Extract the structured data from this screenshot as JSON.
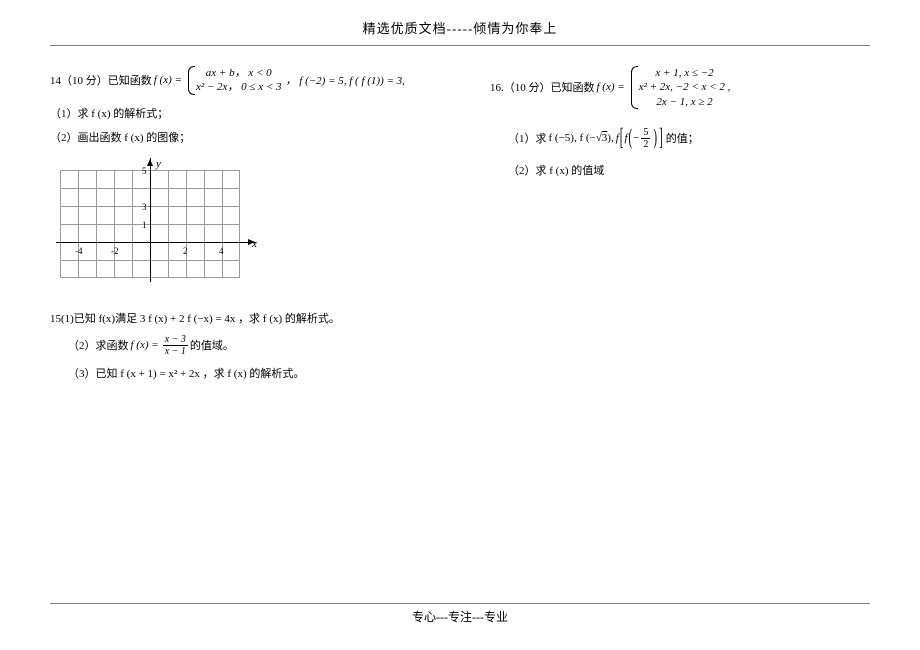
{
  "header": {
    "title": "精选优质文档-----倾情为你奉上"
  },
  "footer": {
    "text": "专心---专注---专业"
  },
  "q14": {
    "stem": "14（10 分）已知函数",
    "fx": "f (x) =",
    "case1": "ax + b，  x < 0",
    "case2": "x² − 2x，  0 ≤ x < 3",
    "tail": "， f (−2) = 5, f ( f (1)) = 3,",
    "p1": "（1）求 f (x) 的解析式；",
    "p2": "（2）画出函数 f (x) 的图像；"
  },
  "grid": {
    "y_label": "y",
    "x_label": "x",
    "x_ticks": [
      "-4",
      "-2",
      "2",
      "4"
    ],
    "y_ticks": [
      "5",
      "3",
      "1"
    ]
  },
  "q15": {
    "p1": "15(1)已知 f(x)满足 3 f (x) + 2 f (−x) = 4x ，求 f (x) 的解析式。",
    "p2a": "（2）求函数",
    "p2_fx": "f (x) =",
    "p2_num": "x − 3",
    "p2_den": "x − 1",
    "p2b": " 的值域。",
    "p3": "（3）已知 f (x + 1) = x² + 2x ，求 f (x) 的解析式。"
  },
  "q16": {
    "stem": "16.（10 分）已知函数",
    "fx": "f (x) =",
    "case1": "x + 1,     x ≤ −2",
    "case2": "x² + 2x,   −2 < x < 2 ,",
    "case3": "2x − 1,    x ≥ 2",
    "p1a": "（1）求",
    "p1_vals": "f (−5), f (−√3 ),",
    "p1_f": "f",
    "p1_inner": "f",
    "p1_frac_num": "5",
    "p1_frac_den": "2",
    "p1b": "的值；",
    "p2": "（2）求 f (x) 的值域"
  }
}
